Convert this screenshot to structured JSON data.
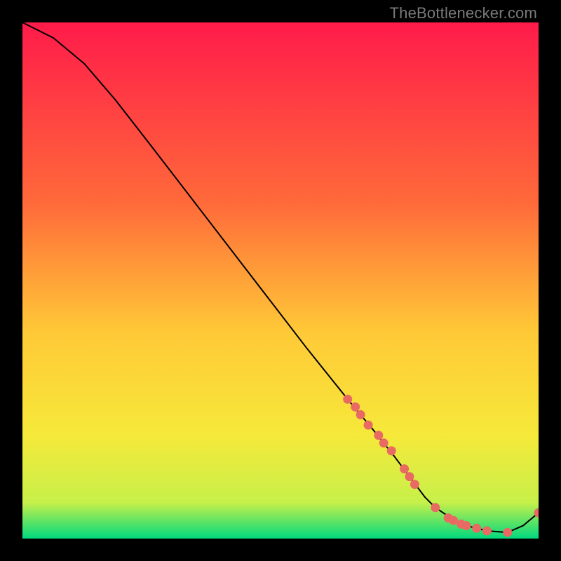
{
  "watermark": "TheBottlenecker.com",
  "gradient": {
    "top": "#ff1b4a",
    "mid1": "#ff6a3a",
    "mid2": "#ffc937",
    "mid3": "#f6e93a",
    "low": "#c7f04a",
    "bottom": "#00d97e"
  },
  "chart_data": {
    "type": "line",
    "title": "",
    "xlabel": "",
    "ylabel": "",
    "xlim": [
      0,
      100
    ],
    "ylim": [
      0,
      100
    ],
    "series": [
      {
        "name": "curve",
        "x": [
          0,
          6,
          12,
          18,
          25,
          35,
          45,
          55,
          63,
          68,
          72,
          75,
          78,
          80,
          83,
          86,
          90,
          94,
          97,
          100
        ],
        "y": [
          100,
          97,
          92,
          85,
          76,
          63,
          50,
          37,
          27,
          21,
          16,
          12,
          8,
          6,
          4,
          2.5,
          1.5,
          1.2,
          2.5,
          5
        ]
      }
    ],
    "highlight_points": {
      "name": "markers",
      "color": "#e86a63",
      "x": [
        63,
        64.5,
        65.5,
        67,
        69,
        70,
        71.5,
        74,
        75,
        76,
        80,
        82.5,
        83.5,
        85,
        86,
        88,
        90,
        94,
        100
      ],
      "y": [
        27,
        25.5,
        24,
        22,
        20,
        18.5,
        17,
        13.5,
        12,
        10.5,
        6,
        4,
        3.5,
        2.8,
        2.5,
        2,
        1.5,
        1.2,
        5
      ]
    }
  }
}
